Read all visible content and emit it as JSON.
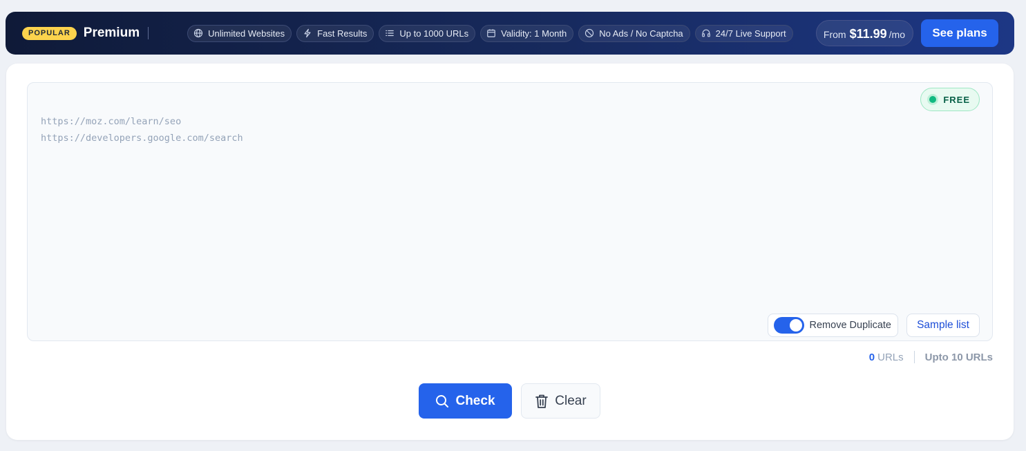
{
  "banner": {
    "badge": "POPULAR",
    "title": "Premium",
    "features": [
      {
        "icon": "globe-icon",
        "label": "Unlimited Websites"
      },
      {
        "icon": "lightning-icon",
        "label": "Fast Results"
      },
      {
        "icon": "list-icon",
        "label": "Up to 1000 URLs"
      },
      {
        "icon": "calendar-icon",
        "label": "Validity: 1 Month"
      },
      {
        "icon": "no-ads-icon",
        "label": "No Ads / No Captcha"
      },
      {
        "icon": "headset-icon",
        "label": "24/7 Live Support"
      }
    ],
    "price_prefix": "From",
    "price": "$11.99",
    "price_suffix": "/mo",
    "cta_label": "See plans"
  },
  "editor": {
    "placeholder": "https://moz.com/learn/seo\nhttps://developers.google.com/search",
    "value": "",
    "free_badge": "FREE",
    "remove_duplicate": {
      "label": "Remove Duplicate",
      "enabled": true
    },
    "sample_list_label": "Sample list"
  },
  "counts": {
    "url_count": "0",
    "url_unit": "URLs",
    "limit": "Upto 10 URLs"
  },
  "actions": {
    "check_label": "Check",
    "clear_label": "Clear"
  },
  "colors": {
    "accent": "#2563eb",
    "banner_dark": "#0f1a38",
    "badge_yellow": "#fcd34d",
    "free_green": "#10b981"
  }
}
